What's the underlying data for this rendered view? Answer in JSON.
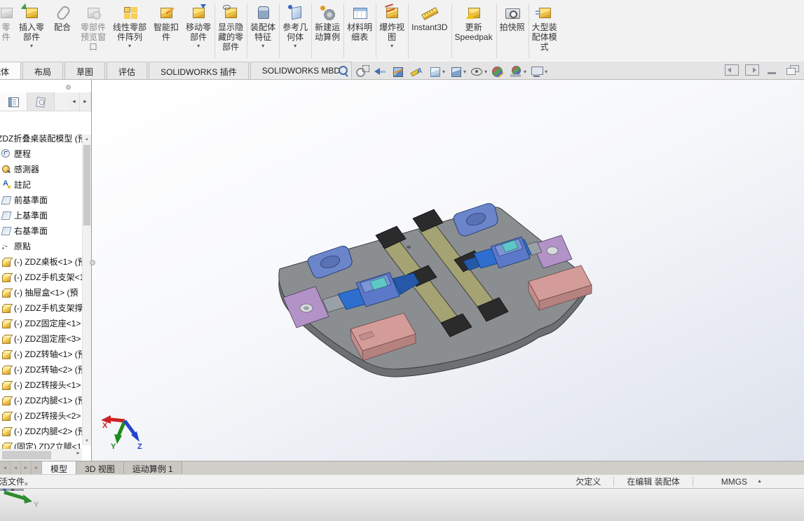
{
  "ribbon": {
    "buttons": [
      {
        "name": "edit-part-button-partial",
        "icon": "i-generic",
        "label": "零\n件",
        "disabled": true,
        "partial": true
      },
      {
        "name": "insert-components-button",
        "icon": "i-insert",
        "label": "插入零\n部件",
        "dropdown": true,
        "caret": "▾"
      },
      {
        "name": "mate-button",
        "icon": "i-mate",
        "label": "配合"
      },
      {
        "name": "component-preview-window-button",
        "icon": "i-preview",
        "label": "零部件\n预览窗\n口",
        "disabled": true
      },
      {
        "name": "linear-component-pattern-button",
        "icon": "i-linear",
        "label": "线性零部\n件阵列",
        "dropdown": true,
        "caret": "▾"
      },
      {
        "name": "smart-fasteners-button",
        "icon": "i-smart",
        "label": "智能扣\n件"
      },
      {
        "name": "move-component-button",
        "icon": "i-move",
        "label": "移动零\n部件",
        "dropdown": true,
        "caret": "▾"
      },
      {
        "name": "show-hidden-components-button",
        "icon": "i-show-hidden",
        "label": "显示隐\n藏的零\n部件",
        "sep": true
      },
      {
        "name": "assembly-features-button",
        "icon": "i-asmfeat",
        "label": "装配体\n特征",
        "dropdown": true,
        "caret": "▾",
        "sep": true
      },
      {
        "name": "reference-geometry-button",
        "icon": "i-refgeo",
        "label": "参考几\n何体",
        "dropdown": true,
        "caret": "▾",
        "sep": true
      },
      {
        "name": "new-motion-study-button",
        "icon": "i-motion",
        "label": "新建运\n动算例",
        "sep": true
      },
      {
        "name": "bill-of-materials-button",
        "icon": "i-bom",
        "label": "材料明\n细表",
        "sep": true
      },
      {
        "name": "exploded-view-button",
        "icon": "i-exploded",
        "label": "爆炸视\n图",
        "dropdown": true,
        "caret": "▾",
        "sep": true
      },
      {
        "name": "instant3d-button",
        "icon": "i-instant3d",
        "label": "Instant3D",
        "sep": true
      },
      {
        "name": "update-speedpak-button",
        "icon": "i-speedpak",
        "label": "更新\nSpeedpak",
        "sep": true
      },
      {
        "name": "take-snapshot-button",
        "icon": "i-snapshot",
        "label": "拍快照",
        "sep": true
      },
      {
        "name": "large-assembly-mode-button",
        "icon": "i-lam",
        "label": "大型装\n配体模\n式",
        "sep": true
      }
    ]
  },
  "command_tabs": {
    "items": [
      {
        "label": "装配体",
        "active": true,
        "partial": true
      },
      {
        "label": "布局"
      },
      {
        "label": "草图"
      },
      {
        "label": "评估"
      },
      {
        "label": "SOLIDWORKS 插件"
      },
      {
        "label": "SOLIDWORKS MBD"
      }
    ]
  },
  "headsup": {
    "icons": [
      {
        "name": "zoom-to-fit-icon",
        "icon": "hi-zoomfit"
      },
      {
        "name": "zoom-to-area-icon",
        "icon": "hi-zoomarea"
      },
      {
        "name": "previous-view-icon",
        "icon": "hi-prevview"
      },
      {
        "name": "section-view-icon",
        "icon": "hi-section"
      },
      {
        "name": "dynamic-annotation-views-icon",
        "icon": "hi-annot"
      },
      {
        "name": "view-orientation-icon",
        "icon": "hi-orient",
        "dropdown": true,
        "caret": "▾"
      },
      {
        "name": "display-style-icon",
        "icon": "hi-style",
        "dropdown": true,
        "caret": "▾"
      },
      {
        "name": "hide-show-items-icon",
        "icon": "hi-eye",
        "dropdown": true,
        "caret": "▾"
      },
      {
        "name": "edit-appearance-icon",
        "icon": "hi-appearance"
      },
      {
        "name": "apply-scene-icon",
        "icon": "hi-scene",
        "dropdown": true,
        "caret": "▾"
      },
      {
        "name": "view-settings-icon",
        "icon": "hi-monitor",
        "dropdown": true,
        "caret": "▾"
      }
    ]
  },
  "window_controls": {
    "items": [
      {
        "name": "dock-pane-left-button",
        "icon": "wc-dockl"
      },
      {
        "name": "dock-pane-right-button",
        "icon": "wc-dockr"
      },
      {
        "name": "minimize-button",
        "icon": "wc-min"
      },
      {
        "name": "restore-button",
        "icon": "wc-restore"
      }
    ]
  },
  "feature_panel": {
    "root": "ZDZ折叠桌装配模型 (预",
    "tabs_arrows": {
      "left": "◄",
      "right": "►"
    },
    "scroll": {
      "up": "▲",
      "down": "▼",
      "right": "►"
    },
    "items": [
      {
        "icon": "ti-history",
        "label": "歷程"
      },
      {
        "icon": "ti-sensor",
        "label": "感測器"
      },
      {
        "icon": "ti-annotation",
        "label": "註記"
      },
      {
        "icon": "ti-plane",
        "label": "前基準面"
      },
      {
        "icon": "ti-plane",
        "label": "上基準面"
      },
      {
        "icon": "ti-plane",
        "label": "右基準面"
      },
      {
        "icon": "ti-origin",
        "label": "原點"
      },
      {
        "icon": "ti-part",
        "label": "(-) ZDZ桌板<1> (预"
      },
      {
        "icon": "ti-part",
        "label": "(-) ZDZ手机支架<1"
      },
      {
        "icon": "ti-part",
        "label": "(-) 抽屉盒<1> (預"
      },
      {
        "icon": "ti-part",
        "label": "(-) ZDZ手机支架撑"
      },
      {
        "icon": "ti-part",
        "label": "(-) ZDZ固定座<1>"
      },
      {
        "icon": "ti-part",
        "label": "(-) ZDZ固定座<3>"
      },
      {
        "icon": "ti-part",
        "label": "(-) ZDZ转轴<1> (预"
      },
      {
        "icon": "ti-part",
        "label": "(-) ZDZ转轴<2> (预"
      },
      {
        "icon": "ti-part",
        "label": "(-) ZDZ转接头<1>"
      },
      {
        "icon": "ti-part",
        "label": "(-) ZDZ内腿<1> (预"
      },
      {
        "icon": "ti-part",
        "label": "(-) ZDZ转接头<2>"
      },
      {
        "icon": "ti-part",
        "label": "(-) ZDZ内腿<2> (预"
      },
      {
        "icon": "ti-part",
        "label": "(固定) ZDZ立腿<1"
      }
    ]
  },
  "doc_tabs": {
    "nav": [
      "◄",
      "◄",
      "►",
      "►"
    ],
    "tabs": [
      {
        "label": "模型",
        "active": true
      },
      {
        "label": "3D 视图"
      },
      {
        "label": "运动算例 1"
      }
    ]
  },
  "status_bar": {
    "left": "激活文件。",
    "constraint": "欠定义",
    "editing": "在编辑 装配体",
    "units": "MMGS",
    "units_caret": "▲"
  },
  "triad": {
    "x": "X",
    "y": "Y",
    "z": "Z"
  },
  "understrip": {
    "axis": "Y"
  },
  "colors": {
    "board": "#8a8e91",
    "board_side": "#6d7073",
    "rail": "#a5a273",
    "cap": "#2b2b2b",
    "leg_blue": "#2e6ecf",
    "clamp_blue": "#5b79c8",
    "plate_purple": "#b393c7",
    "box_pink": "#d49c99",
    "accent_teal": "#5fc8c4",
    "bg_top": "#ffffff",
    "bg_bottom": "#dde2ec"
  }
}
